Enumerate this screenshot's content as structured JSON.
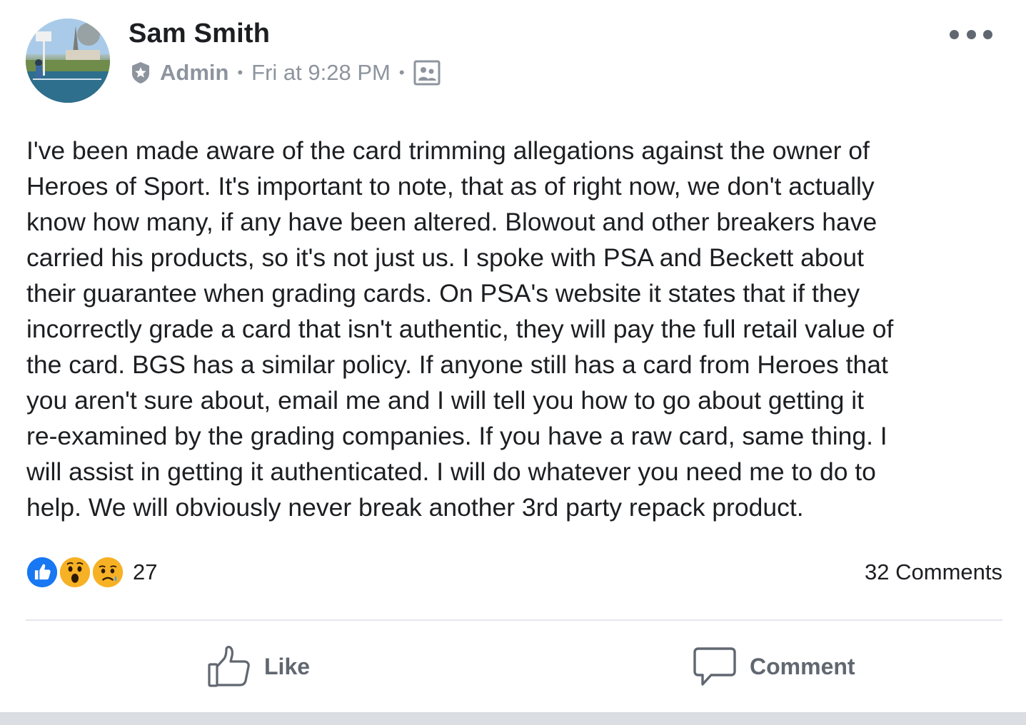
{
  "post": {
    "author": "Sam Smith",
    "role": "Admin",
    "timestamp": "Fri at 9:28 PM",
    "body": "I've been made aware of the card trimming allegations against the owner of\nHeroes of Sport.  It's important to note, that as of right now, we don't actually\nknow how many, if any have been altered.  Blowout and other breakers have\ncarried his products, so it's not just us. I spoke with PSA and Beckett about\ntheir guarantee when grading cards. On PSA's website it states that if they\nincorrectly grade a card that isn't authentic, they will pay the full retail value of\nthe card. BGS has a similar policy.  If anyone still has a card from Heroes that\nyou aren't sure about, email me and I will tell you how to go about getting it\nre-examined by the grading companies.  If you have a raw card, same thing. I\nwill assist in getting it authenticated. I will do whatever you need me to do to\nhelp. We will obviously never break another 3rd party repack product."
  },
  "icons": {
    "admin_badge": "star-badge-icon",
    "audience": "group-members-icon",
    "more": "more-dots-icon",
    "like": "thumbs-up-icon",
    "comment": "speech-bubble-icon"
  },
  "reactions": {
    "types": [
      "like",
      "wow",
      "sad"
    ],
    "count": "27"
  },
  "comments_count": "32 Comments",
  "actions": {
    "like_label": "Like",
    "comment_label": "Comment"
  },
  "colors": {
    "like_blue": "#1877f2",
    "emoji_yellow": "#f7b125",
    "meta_gray": "#8d949e",
    "action_gray": "#606770"
  }
}
